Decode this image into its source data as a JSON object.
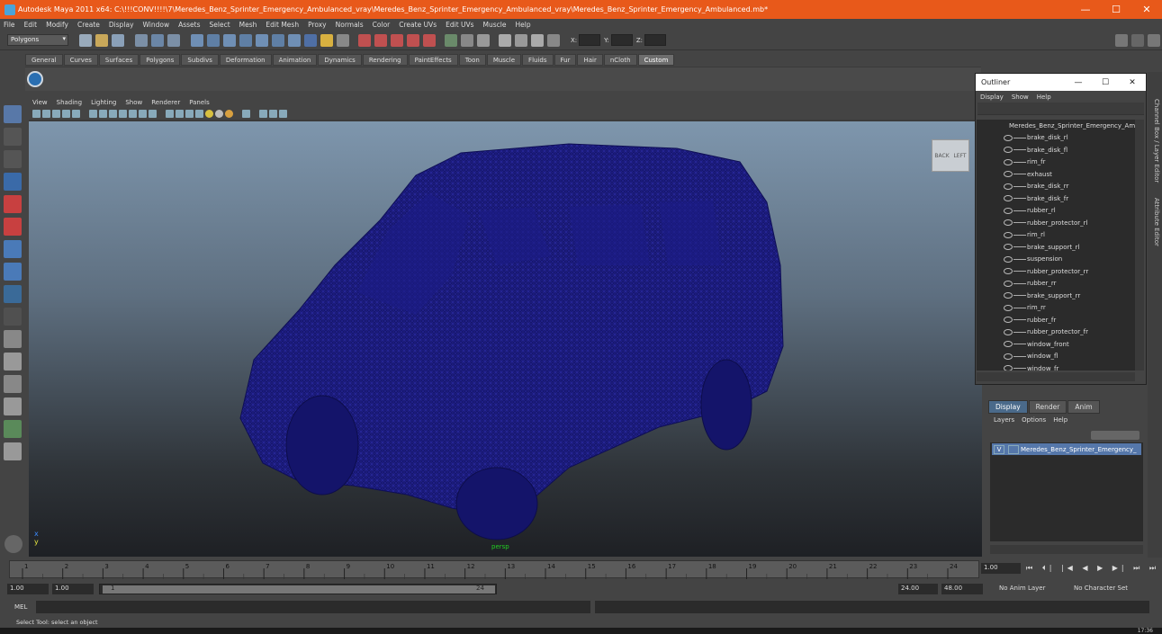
{
  "window": {
    "title": "Autodesk Maya 2011 x64: C:\\!!!CONV!!!!\\7\\Meredes_Benz_Sprinter_Emergency_Ambulanced_vray\\Meredes_Benz_Sprinter_Emergency_Ambulanced_vray\\Meredes_Benz_Sprinter_Emergency_Ambulanced.mb*",
    "minimize": "—",
    "maximize": "☐",
    "close": "✕"
  },
  "menubar": [
    "File",
    "Edit",
    "Modify",
    "Create",
    "Display",
    "Window",
    "Assets",
    "Select",
    "Mesh",
    "Edit Mesh",
    "Proxy",
    "Normals",
    "Color",
    "Create UVs",
    "Edit UVs",
    "Muscle",
    "Help"
  ],
  "statusline": {
    "mode": "Polygons",
    "x_label": "X:",
    "y_label": "Y:",
    "z_label": "Z:"
  },
  "shelf_tabs": [
    "General",
    "Curves",
    "Surfaces",
    "Polygons",
    "Subdivs",
    "Deformation",
    "Animation",
    "Dynamics",
    "Rendering",
    "PaintEffects",
    "Toon",
    "Muscle",
    "Fluids",
    "Fur",
    "Hair",
    "nCloth",
    "Custom"
  ],
  "shelf_active": "Custom",
  "viewport": {
    "menu": [
      "View",
      "Shading",
      "Lighting",
      "Show",
      "Renderer",
      "Panels"
    ],
    "camera_label": "persp",
    "viewcube_back": "BACK",
    "viewcube_left": "LEFT",
    "axis_x": "x",
    "axis_y": "y",
    "mesh_color": "#1a1a7a"
  },
  "outliner": {
    "title": "Outliner",
    "menu": [
      "Display",
      "Show",
      "Help"
    ],
    "root": "Meredes_Benz_Sprinter_Emergency_Am",
    "items": [
      "brake_disk_rl",
      "brake_disk_fl",
      "rim_fr",
      "exhaust",
      "brake_disk_rr",
      "brake_disk_fr",
      "rubber_rl",
      "rubber_protector_rl",
      "rim_rl",
      "brake_support_rl",
      "suspension",
      "rubber_protector_rr",
      "rubber_rr",
      "brake_support_rr",
      "rim_rr",
      "rubber_fr",
      "rubber_protector_fr",
      "window_front",
      "window_fl",
      "window_fr"
    ]
  },
  "side_tabs": [
    "Channel Box / Layer Editor",
    "Attribute Editor"
  ],
  "layer_editor": {
    "tabs": [
      "Display",
      "Render",
      "Anim"
    ],
    "active_tab": "Display",
    "menu": [
      "Layers",
      "Options",
      "Help"
    ],
    "layer_visible": "V",
    "layer_name": "Meredes_Benz_Sprinter_Emergency_"
  },
  "timeline": {
    "ticks": [
      "1",
      "2",
      "3",
      "4",
      "5",
      "6",
      "7",
      "8",
      "9",
      "10",
      "11",
      "12",
      "13",
      "14",
      "15",
      "16",
      "17",
      "18",
      "19",
      "20",
      "21",
      "22",
      "23",
      "24"
    ],
    "current_frame": "1.00",
    "controls": "⏮ ⏴| |◀ ◀ ▶ ▶| ⏭ ⏭"
  },
  "range": {
    "start": "1.00",
    "start_inner": "1.00",
    "slider_start": "1",
    "slider_end": "24",
    "end_inner": "24.00",
    "end": "48.00",
    "anim_layer": "No Anim Layer",
    "character_set": "No Character Set"
  },
  "cmdline": {
    "label": "MEL"
  },
  "helpline": {
    "text": "Select Tool: select an object"
  },
  "taskbar": {
    "clock": "17:36"
  }
}
